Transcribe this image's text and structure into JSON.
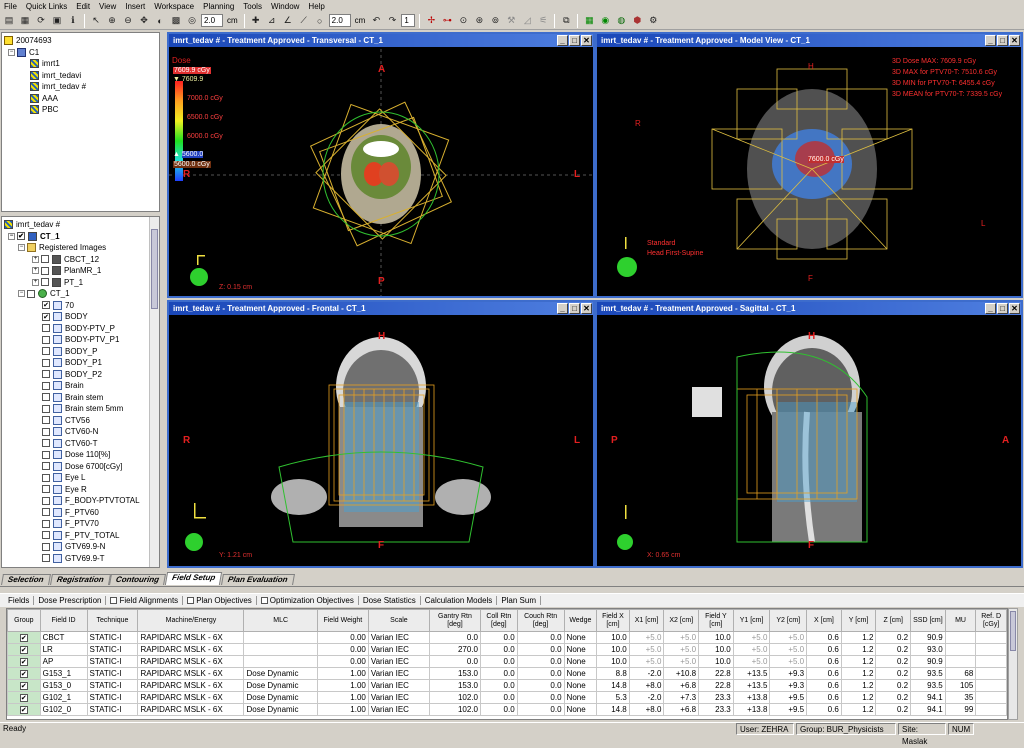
{
  "menu": [
    "File",
    "Quick Links",
    "Edit",
    "View",
    "Insert",
    "Workspace",
    "Planning",
    "Tools",
    "Window",
    "Help"
  ],
  "toolbar": {
    "width_value_1": "2.0",
    "unit_1": "cm",
    "width_value_2": "2.0",
    "unit_2": "cm",
    "counter": "1"
  },
  "course_tree": {
    "patient_id": "20074693",
    "course": "C1",
    "plans": [
      "imrt1",
      "imrt_tedavi",
      "imrt_tedav #",
      "AAA",
      "PBC"
    ]
  },
  "structure_tree": {
    "root": "imrt_tedav #",
    "image": "CT_1",
    "registered_group": "Registered Images",
    "registered": [
      "CBCT_12",
      "PlanMR_1",
      "PT_1"
    ],
    "ct_node": "CT_1",
    "structures": [
      "70",
      "BODY",
      "BODY-PTV_P",
      "BODY-PTV_P1",
      "BODY_P",
      "BODY_P1",
      "BODY_P2",
      "Brain",
      "Brain stem",
      "Brain stem 5mm",
      "CTV56",
      "CTV60-N",
      "CTV60-T",
      "Dose 110[%]",
      "Dose 6700[cGy]",
      "Eye L",
      "Eye R",
      "F_BODY-PTVTOTAL",
      "F_PTV60",
      "F_PTV70",
      "F_PTV_TOTAL",
      "GTV69.9-N",
      "GTV69.9-T"
    ]
  },
  "viewports": {
    "transversal": {
      "title": "imrt_tedav # - Treatment Approved - Transversal - CT_1",
      "top": "A",
      "bottom": "P",
      "left": "R",
      "right": "L",
      "coord": "Z: 0.15 cm",
      "dose_legend": {
        "title": "Dose",
        "max": "7609.9 cGy",
        "top": "7609.9",
        "levels": [
          "7000.0 cGy",
          "6500.0 cGy",
          "6000.0 cGy"
        ],
        "low": "5600.0",
        "min": "5600.0 cGy"
      }
    },
    "model": {
      "title": "imrt_tedav # - Treatment Approved - Model View - CT_1",
      "top": "H",
      "bottom": "F",
      "left": "R",
      "right": "L",
      "stats": [
        "3D Dose MAX: 7609.9 cGy",
        "3D MAX for PTV70-T: 7510.6 cGy",
        "3D MIN for PTV70-T: 6455.4 cGy",
        "3D MEAN for PTV70-T: 7339.5 cGy"
      ],
      "orientation": "Standard",
      "position": "Head First-Supine",
      "dose_point": "7600.0 cGy"
    },
    "frontal": {
      "title": "imrt_tedav # - Treatment Approved - Frontal - CT_1",
      "top": "H",
      "bottom": "F",
      "left": "R",
      "right": "L",
      "coord": "Y: 1.21 cm"
    },
    "sagittal": {
      "title": "imrt_tedav # - Treatment Approved - Sagittal - CT_1",
      "top": "H",
      "bottom": "F",
      "left": "P",
      "right": "A",
      "coord": "X: 0.65 cm"
    }
  },
  "workspace_tabs": [
    "Selection",
    "Registration",
    "Contouring",
    "Field Setup",
    "Plan Evaluation"
  ],
  "active_workspace": "Field Setup",
  "sub_tabs": [
    {
      "label": "Fields",
      "checkbox": false
    },
    {
      "label": "Dose Prescription",
      "checkbox": false
    },
    {
      "label": "Field Alignments",
      "checkbox": true
    },
    {
      "label": "Plan Objectives",
      "checkbox": true
    },
    {
      "label": "Optimization Objectives",
      "checkbox": true
    },
    {
      "label": "Dose Statistics",
      "checkbox": false
    },
    {
      "label": "Calculation Models",
      "checkbox": false
    },
    {
      "label": "Plan Sum",
      "checkbox": false
    }
  ],
  "field_table": {
    "columns": [
      "Group",
      "Field ID",
      "Technique",
      "Machine/Energy",
      "MLC",
      "Field Weight",
      "Scale",
      "Gantry Rtn [deg]",
      "Coll Rtn [deg]",
      "Couch Rtn [deg]",
      "Wedge",
      "Field X [cm]",
      "X1 [cm]",
      "X2 [cm]",
      "Field Y [cm]",
      "Y1 [cm]",
      "Y2 [cm]",
      "X [cm]",
      "Y [cm]",
      "Z [cm]",
      "SSD [cm]",
      "MU",
      "Ref. D [cGy]"
    ],
    "rows": [
      [
        "✔",
        "CBCT",
        "STATIC-I",
        "RAPIDARC MSLK - 6X",
        "",
        "0.00",
        "Varian IEC",
        "0.0",
        "0.0",
        "0.0",
        "None",
        "10.0",
        "+5.0",
        "+5.0",
        "10.0",
        "+5.0",
        "+5.0",
        "0.6",
        "1.2",
        "0.2",
        "90.9",
        "",
        ""
      ],
      [
        "✔",
        "LR",
        "STATIC-I",
        "RAPIDARC MSLK - 6X",
        "",
        "0.00",
        "Varian IEC",
        "270.0",
        "0.0",
        "0.0",
        "None",
        "10.0",
        "+5.0",
        "+5.0",
        "10.0",
        "+5.0",
        "+5.0",
        "0.6",
        "1.2",
        "0.2",
        "93.0",
        "",
        ""
      ],
      [
        "✔",
        "AP",
        "STATIC-I",
        "RAPIDARC MSLK - 6X",
        "",
        "0.00",
        "Varian IEC",
        "0.0",
        "0.0",
        "0.0",
        "None",
        "10.0",
        "+5.0",
        "+5.0",
        "10.0",
        "+5.0",
        "+5.0",
        "0.6",
        "1.2",
        "0.2",
        "90.9",
        "",
        ""
      ],
      [
        "✔",
        "G153_1",
        "STATIC-I",
        "RAPIDARC MSLK - 6X",
        "Dose Dynamic",
        "1.00",
        "Varian IEC",
        "153.0",
        "0.0",
        "0.0",
        "None",
        "8.8",
        "-2.0",
        "+10.8",
        "22.8",
        "+13.5",
        "+9.3",
        "0.6",
        "1.2",
        "0.2",
        "93.5",
        "68",
        ""
      ],
      [
        "✔",
        "G153_0",
        "STATIC-I",
        "RAPIDARC MSLK - 6X",
        "Dose Dynamic",
        "1.00",
        "Varian IEC",
        "153.0",
        "0.0",
        "0.0",
        "None",
        "14.8",
        "+8.0",
        "+6.8",
        "22.8",
        "+13.5",
        "+9.3",
        "0.6",
        "1.2",
        "0.2",
        "93.5",
        "105",
        ""
      ],
      [
        "✔",
        "G102_1",
        "STATIC-I",
        "RAPIDARC MSLK - 6X",
        "Dose Dynamic",
        "1.00",
        "Varian IEC",
        "102.0",
        "0.0",
        "0.0",
        "None",
        "5.3",
        "-2.0",
        "+7.3",
        "23.3",
        "+13.8",
        "+9.5",
        "0.6",
        "1.2",
        "0.2",
        "94.1",
        "35",
        ""
      ],
      [
        "✔",
        "G102_0",
        "STATIC-I",
        "RAPIDARC MSLK - 6X",
        "Dose Dynamic",
        "1.00",
        "Varian IEC",
        "102.0",
        "0.0",
        "0.0",
        "None",
        "14.8",
        "+8.0",
        "+6.8",
        "23.3",
        "+13.8",
        "+9.5",
        "0.6",
        "1.2",
        "0.2",
        "94.1",
        "99",
        ""
      ]
    ]
  },
  "status": {
    "ready": "Ready",
    "user": "User: ZEHRA",
    "group": "Group: BUR_Physicists",
    "site": "Site: Maslak",
    "num": "NUM"
  }
}
